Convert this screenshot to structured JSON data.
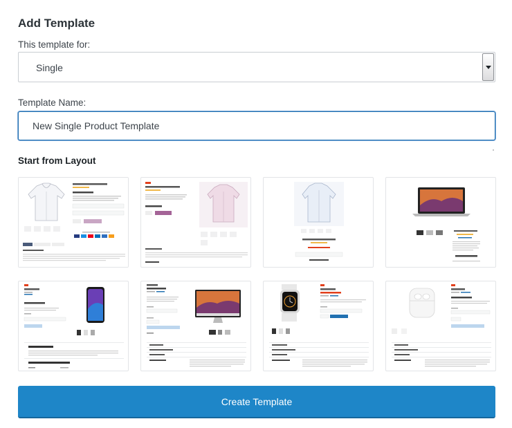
{
  "form": {
    "title": "Add Template",
    "template_for_label": "This template for:",
    "template_for_value": "Single",
    "template_name_label": "Template Name:",
    "template_name_value": "New Single Product Template",
    "layout_section_label": "Start from Layout",
    "create_button_label": "Create Template"
  },
  "layouts": [
    {
      "id": "hoodie-detailed"
    },
    {
      "id": "hoodie-pink"
    },
    {
      "id": "hoodie-centered"
    },
    {
      "id": "macbook"
    },
    {
      "id": "iphone"
    },
    {
      "id": "imac"
    },
    {
      "id": "apple-watch"
    },
    {
      "id": "airpods"
    }
  ],
  "colors": {
    "primary_button": "#1e86c8",
    "input_focus_border": "#2271b1",
    "sale_badge": "#e2401c",
    "add_to_cart": "#a46497"
  }
}
